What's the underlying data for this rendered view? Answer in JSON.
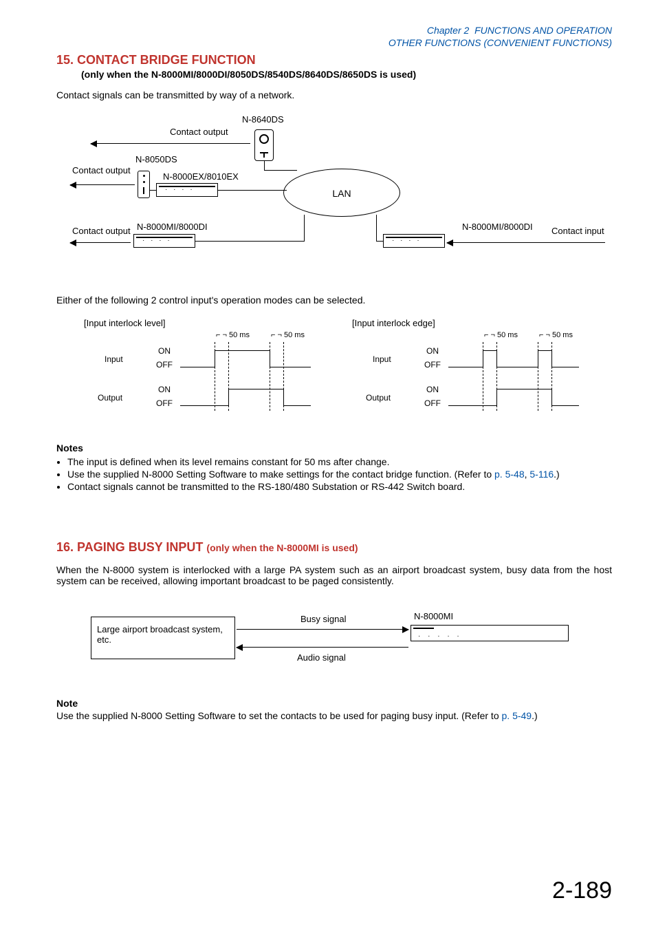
{
  "header": {
    "chapter": "Chapter 2",
    "title1": "FUNCTIONS AND OPERATION",
    "title2": "OTHER FUNCTIONS (CONVENIENT FUNCTIONS)"
  },
  "s15": {
    "heading": "15. CONTACT BRIDGE FUNCTION",
    "subtitle": "(only when the N-8000MI/8000DI/8050DS/8540DS/8640DS/8650DS is used)",
    "intro": "Contact signals can be transmitted by way of a network.",
    "diagram": {
      "contact_output": "Contact output",
      "contact_input": "Contact input",
      "n8640": "N-8640DS",
      "n8050": "N-8050DS",
      "n8000ex": "N-8000EX/8010EX",
      "n8000mi": "N-8000MI/8000DI",
      "lan": "LAN"
    },
    "para2": "Either of the following 2 control input's operation modes can be selected.",
    "tim": {
      "level_title": "[Input interlock level]",
      "edge_title": "[Input interlock edge]",
      "t50": "50 ms",
      "input": "Input",
      "output": "Output",
      "on": "ON",
      "off": "OFF"
    },
    "notes_h": "Notes",
    "notes": [
      "The input is defined when its level remains constant for 50 ms after change.",
      {
        "pre": "Use the supplied N-8000 Setting Software to make settings for the contact bridge function. (Refer to ",
        "l1": "p. 5-48",
        "mid": ", ",
        "l2": "5-116",
        "post": ".)"
      },
      "Contact signals cannot be transmitted to the RS-180/480 Substation or RS-442 Switch board."
    ]
  },
  "s16": {
    "heading": "16. PAGING BUSY INPUT",
    "subtitle": "(only when the N-8000MI is used)",
    "para": "When the N-8000 system is interlocked with a large PA system such as an airport broadcast system, busy data from the host system can be received, allowing important broadcast to be paged consistently.",
    "diagram": {
      "left_box": "Large airport broadcast system, etc.",
      "busy": "Busy signal",
      "audio": "Audio signal",
      "n8000mi": "N-8000MI"
    },
    "note_h": "Note",
    "note": {
      "pre": "Use the supplied N-8000 Setting Software to set the contacts to be used for paging busy input. (Refer to ",
      "l1": "p. 5-49",
      "post": ".)"
    }
  },
  "page_number": "2-189"
}
